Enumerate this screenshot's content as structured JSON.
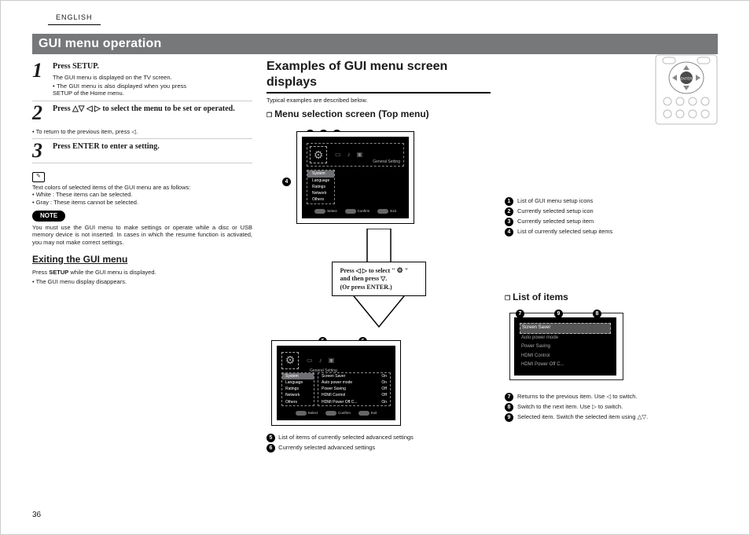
{
  "lang_tab": "ENGLISH",
  "title": "GUI menu operation",
  "steps": [
    {
      "n": "1",
      "lead": "Press SETUP.",
      "lines": [
        "The GUI menu is displayed on the TV screen."
      ],
      "sub": "• The GUI menu is also displayed when you press SETUP of the Home menu."
    },
    {
      "n": "2",
      "lead": "Press △▽ ◁ ▷ to select the menu to be set or operated.",
      "sub": "• To return to the previous item, press ◁."
    },
    {
      "n": "3",
      "lead": "Press ENTER to enter a setting."
    }
  ],
  "colors_note": {
    "intro": "Text colors of selected items of the GUI menu are as follows:",
    "white": "• White : These items can be selected.",
    "gray": "• Gray : These items cannot be selected."
  },
  "note_pill": "NOTE",
  "note_body": "You must use the GUI menu to make settings or operate while a disc or USB memory device is not inserted. In cases in which the resume function is activated, you may not make correct settings.",
  "exit": {
    "h": "Exiting the GUI menu",
    "p1_a": "Press ",
    "p1_b": "SETUP",
    "p1_c": " while the GUI menu is displayed.",
    "p2": "• The GUI menu display disappears."
  },
  "examples_h": "Examples of GUI menu screen displays",
  "examples_sub": "Typical examples are described below.",
  "menu_sel_h": "Menu selection screen (Top menu)",
  "general_setting": "General Setting",
  "top_items": [
    "System",
    "Language",
    "Ratings",
    "Network",
    "Others"
  ],
  "btnrow": {
    "a": "Select",
    "b": "Confirm",
    "c": "Exit"
  },
  "callouts_a": [
    "List of GUI menu setup icons",
    "Currently selected setup icon",
    "Currently selected setup item",
    "List of currently selected setup items"
  ],
  "press_box": {
    "l1a": "Press ◁ ▷ to select \" ",
    "l1b": " \"",
    "l2": "and then press ▽.",
    "l3": "(Or press ENTER.)"
  },
  "screen2": {
    "left": [
      "System",
      "Language",
      "Ratings",
      "Network",
      "Others"
    ],
    "right_labels": [
      "Screen Saver",
      "Auto power mode",
      "Power Saving",
      "HDMI Control",
      "HDMI Power Off C..."
    ],
    "right_vals": [
      "On",
      "On",
      "Off",
      "Off",
      "On"
    ]
  },
  "callouts_b": [
    "List of items of currently selected advanced settings",
    "Currently selected advanced settings"
  ],
  "list_h": "List of items",
  "list_items": [
    "Screen Saver",
    "Auto power mode",
    "Power Saving",
    "HDMI Control",
    "HDMI Power Off C..."
  ],
  "callouts_c": [
    "Returns to the previous item. Use ◁ to switch.",
    "Switch to the next item. Use ▷ to switch.",
    "Selected item. Switch the selected item using △▽."
  ],
  "page_num": "36"
}
